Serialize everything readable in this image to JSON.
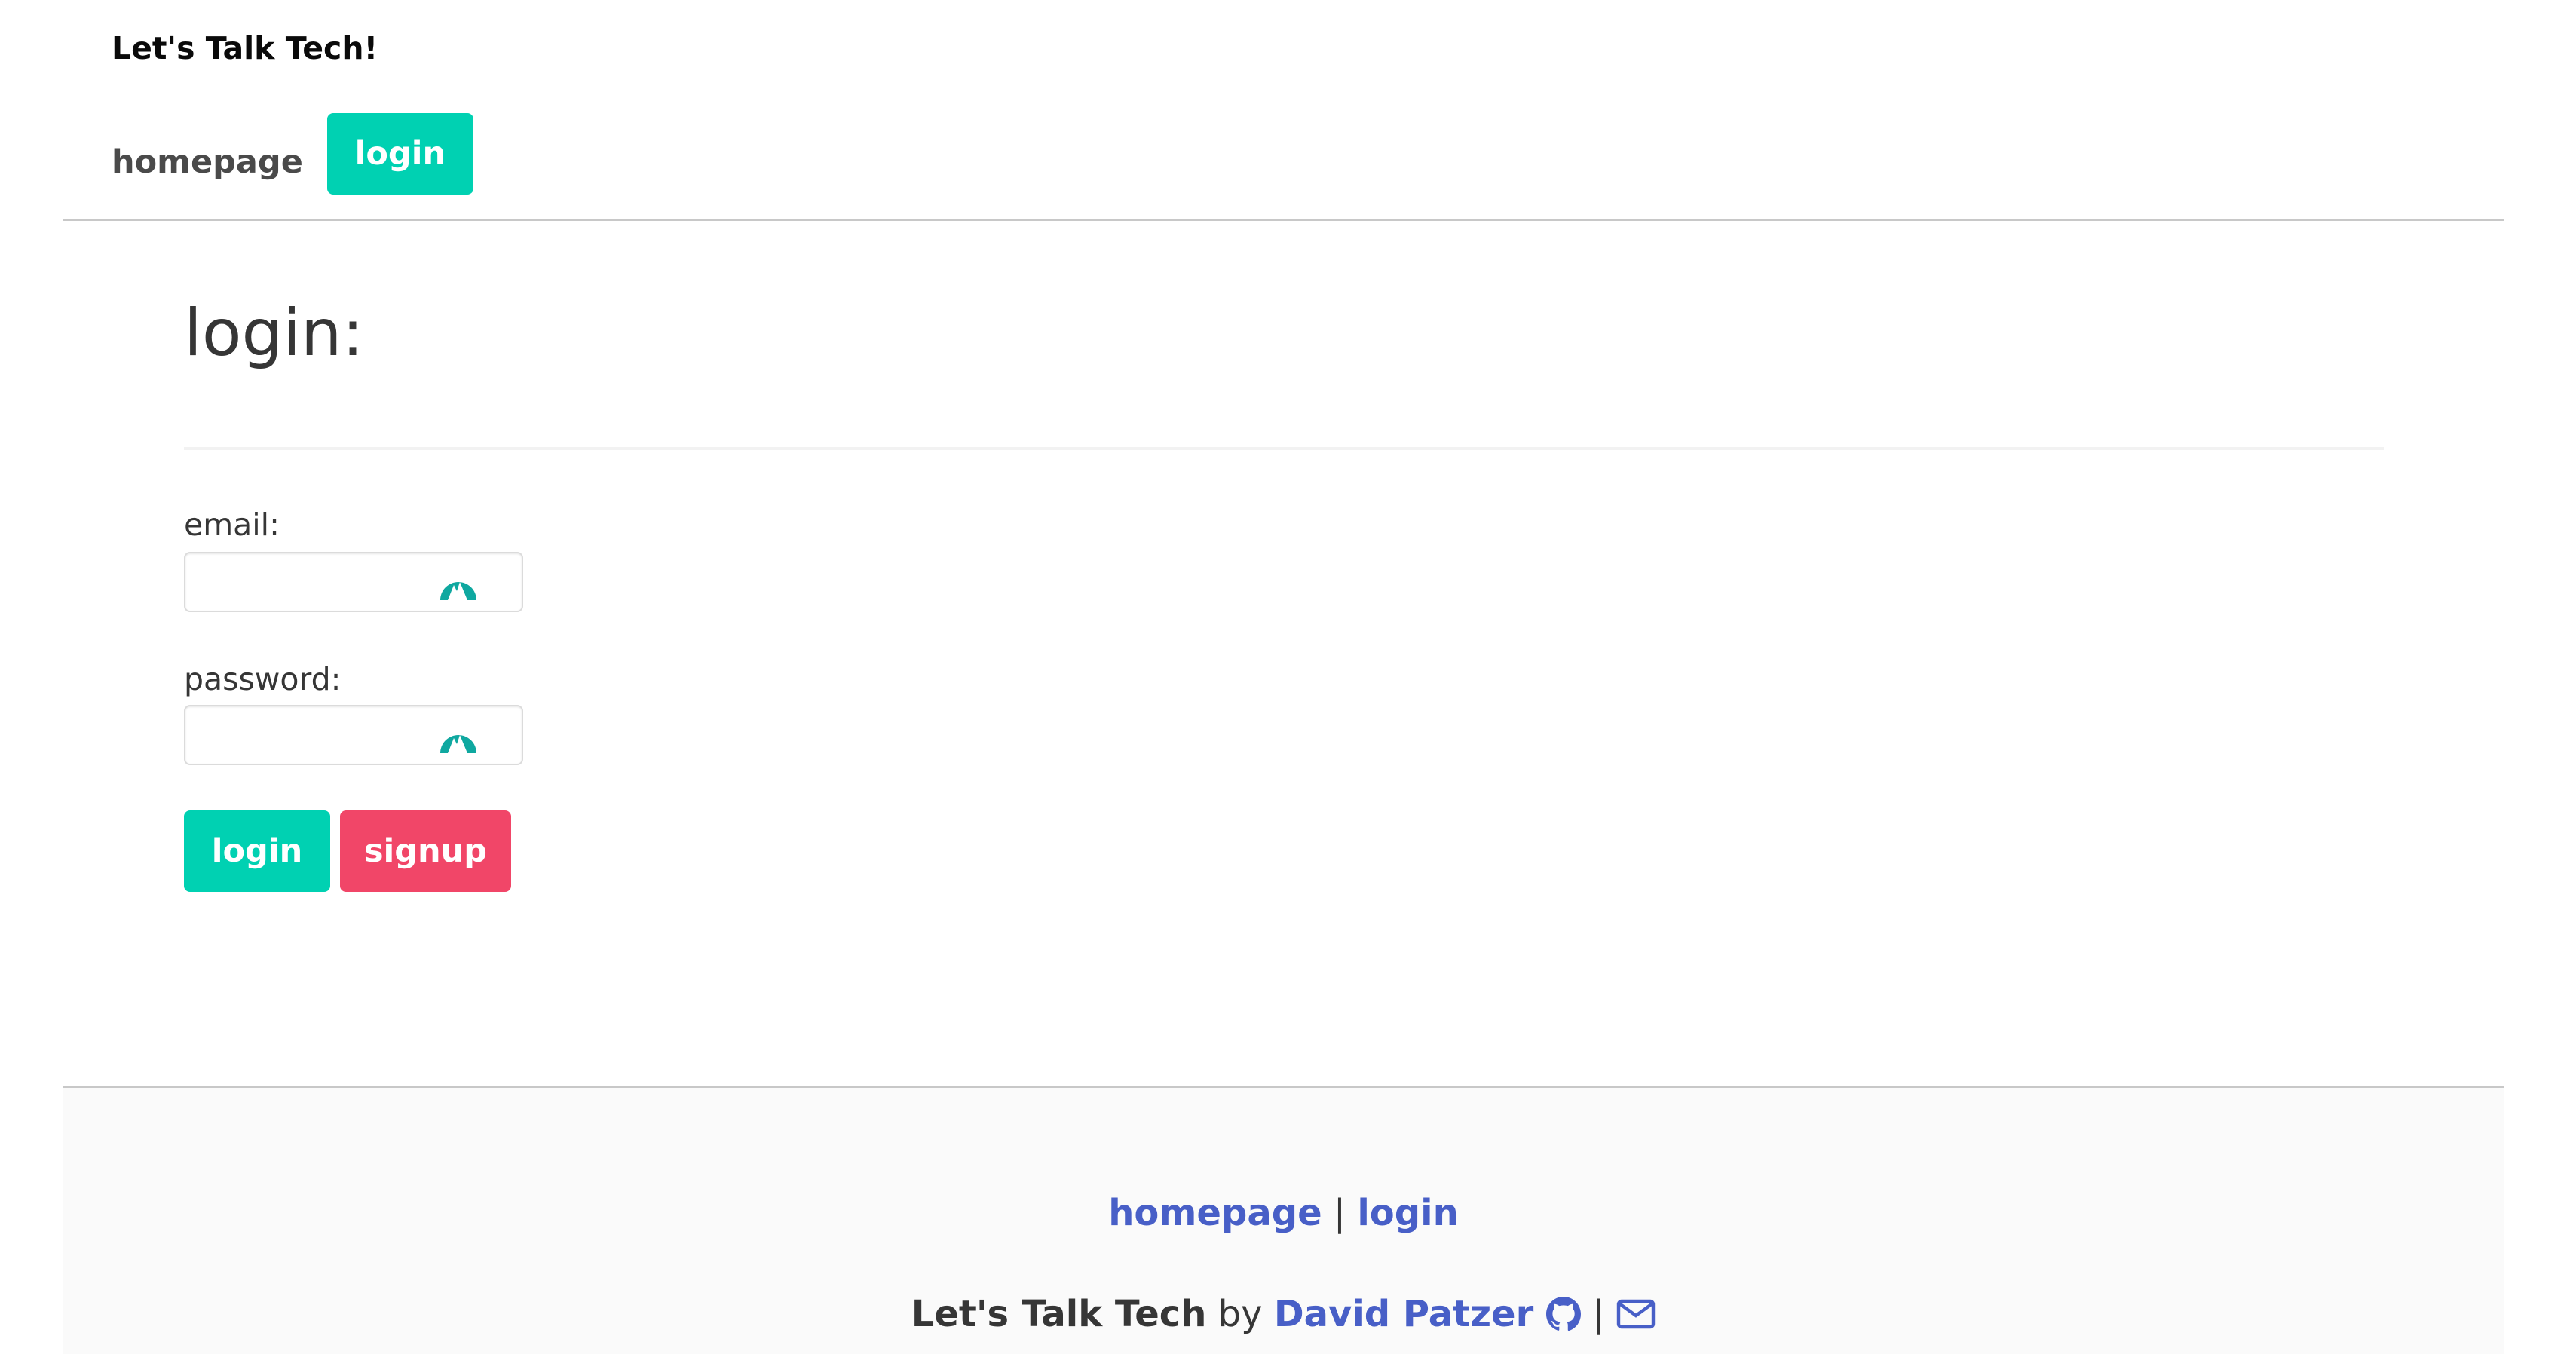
{
  "header": {
    "site_title": "Let's Talk Tech!",
    "nav": {
      "homepage_label": "homepage",
      "login_label": "login"
    }
  },
  "main": {
    "heading": "login:",
    "email_label": "email:",
    "email_value": "",
    "password_label": "password:",
    "password_value": "",
    "login_button": "login",
    "signup_button": "signup"
  },
  "footer": {
    "links": {
      "homepage_label": "homepage",
      "separator": "|",
      "login_label": "login"
    },
    "credit": {
      "site_name": "Let's Talk Tech",
      "by": "by",
      "author": "David Patzer",
      "separator": "|"
    }
  },
  "colors": {
    "primary": "#00d1b2",
    "danger": "#f14668",
    "link": "#485fc7",
    "text": "#363636",
    "vault_icon": "#0fa8a0"
  },
  "icons": {
    "password_manager": "password-manager-icon",
    "github": "github-icon",
    "email": "envelope-icon"
  }
}
